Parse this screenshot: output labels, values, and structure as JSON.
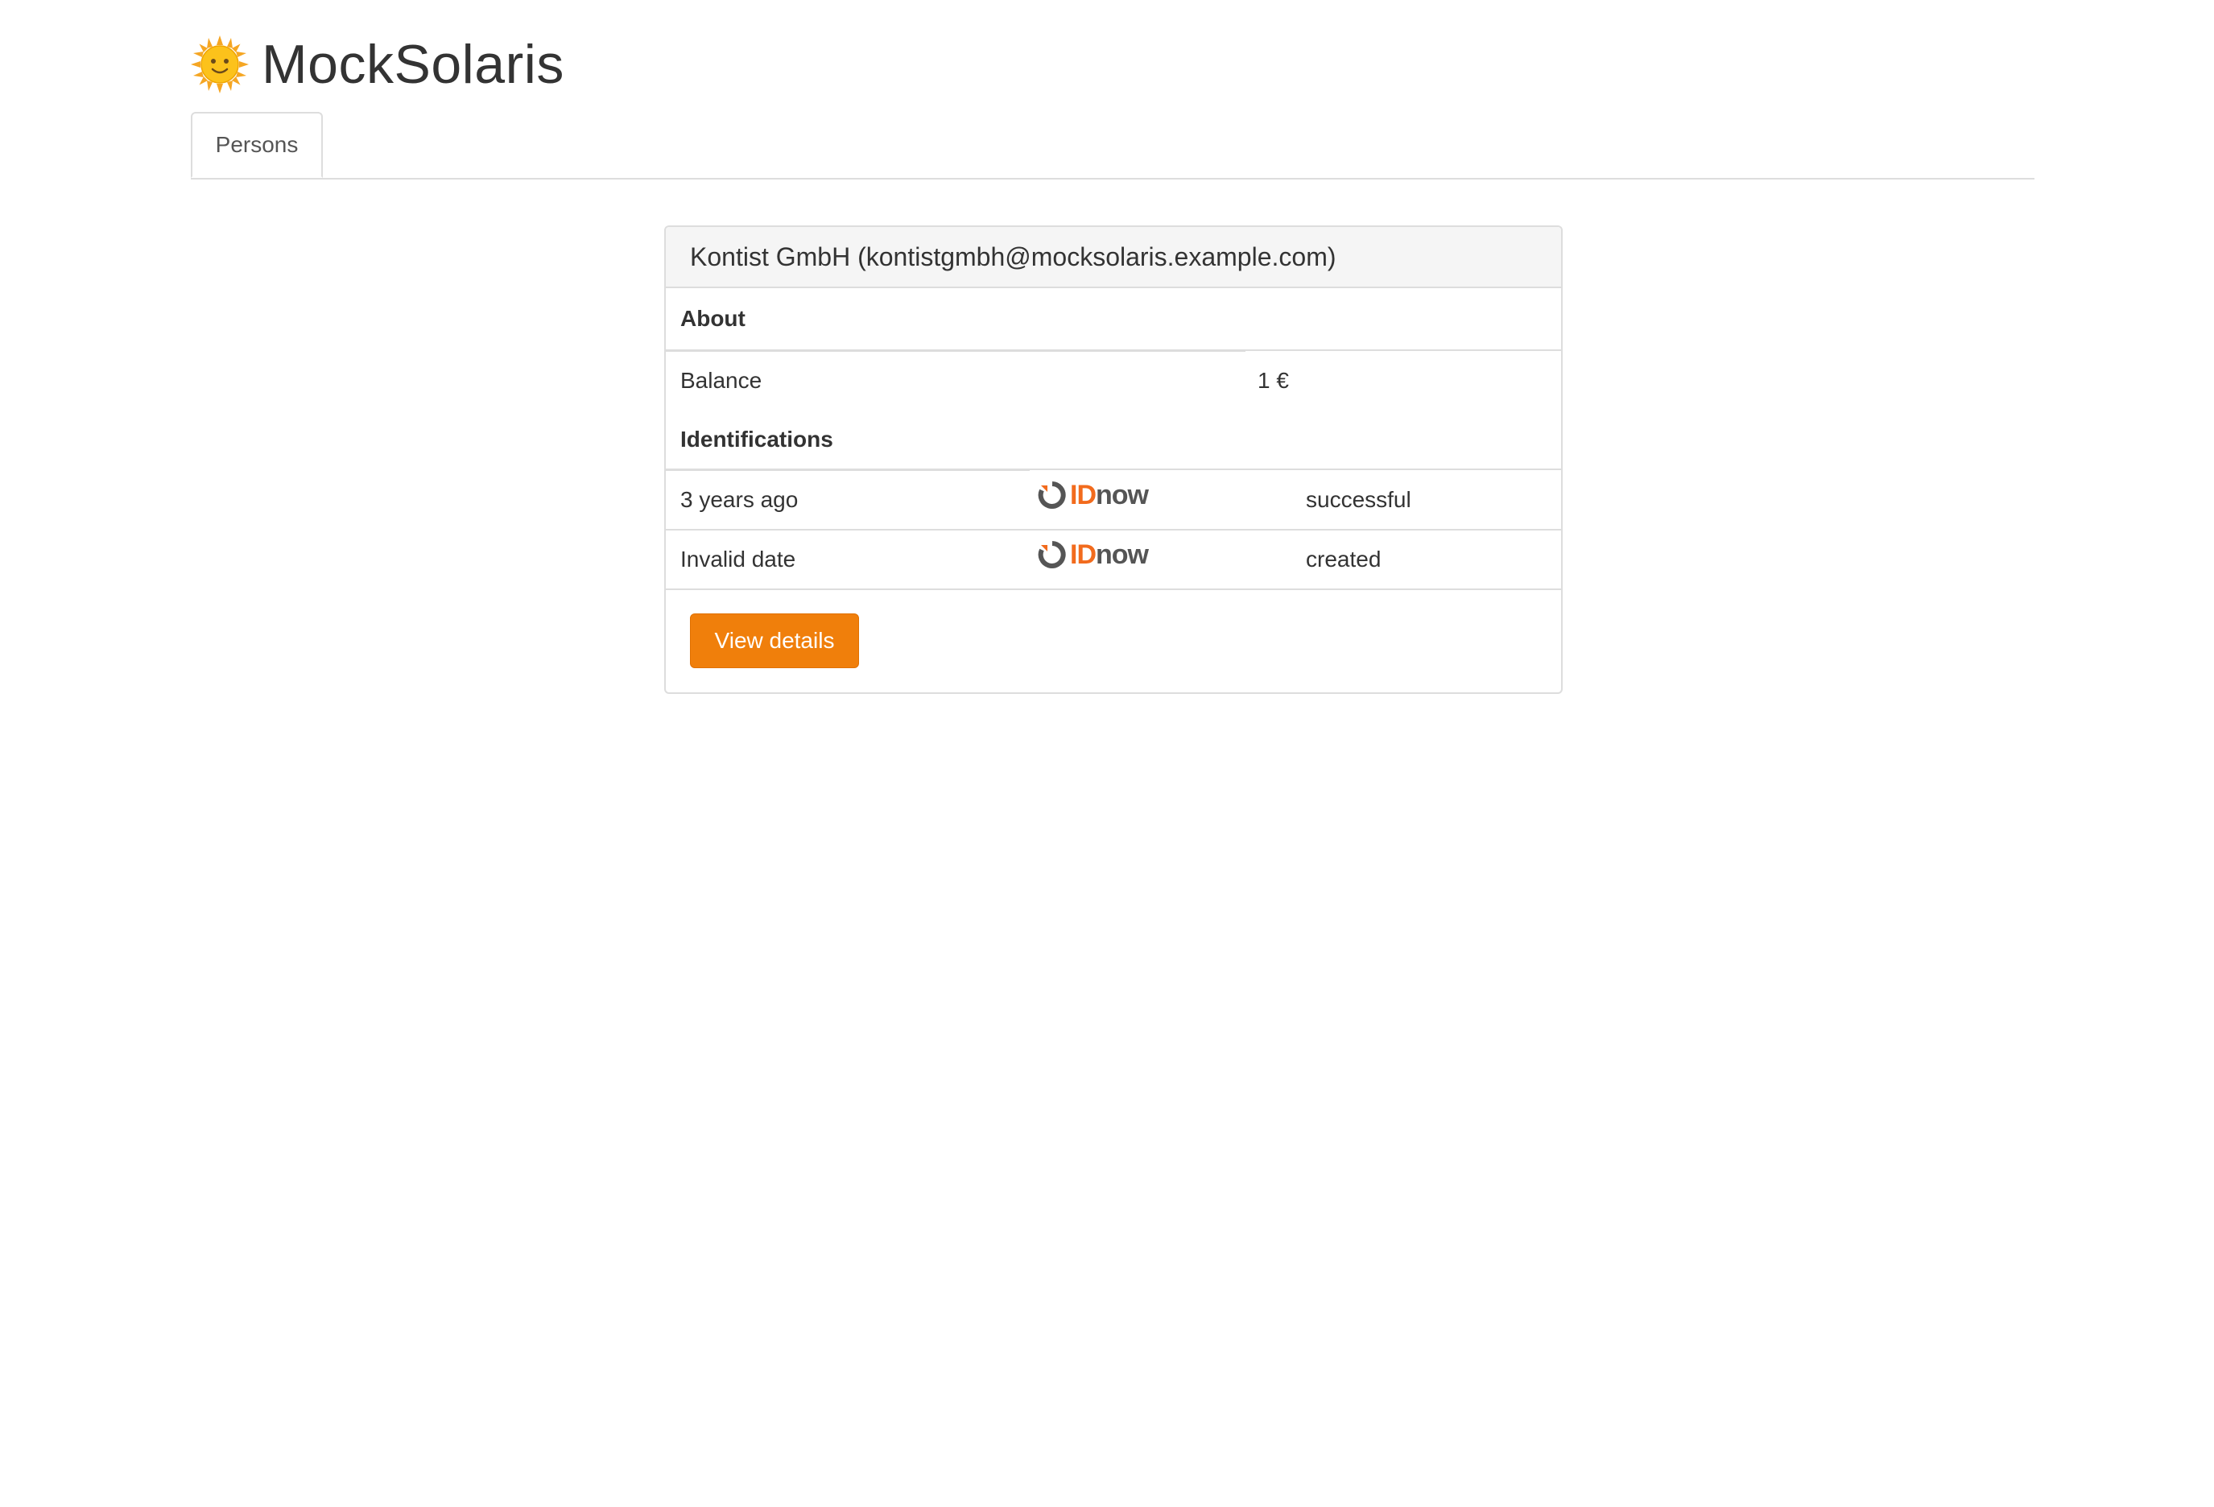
{
  "app": {
    "title": "MockSolaris",
    "logo_icon": "sun-with-face-icon"
  },
  "tabs": [
    {
      "label": "Persons",
      "active": true
    }
  ],
  "person": {
    "heading": "Kontist GmbH (kontistgmbh@mocksolaris.example.com)",
    "about": {
      "title": "About",
      "rows": [
        {
          "label": "Balance",
          "value": "1 €"
        }
      ]
    },
    "identifications": {
      "title": "Identifications",
      "rows": [
        {
          "date": "3 years ago",
          "provider": "IDnow",
          "status": "successful"
        },
        {
          "date": "Invalid date",
          "provider": "IDnow",
          "status": "created"
        }
      ]
    },
    "view_details_label": "View details"
  },
  "colors": {
    "accent": "#f07f0b",
    "idnow_orange": "#f26b1d",
    "idnow_gray": "#555555"
  }
}
